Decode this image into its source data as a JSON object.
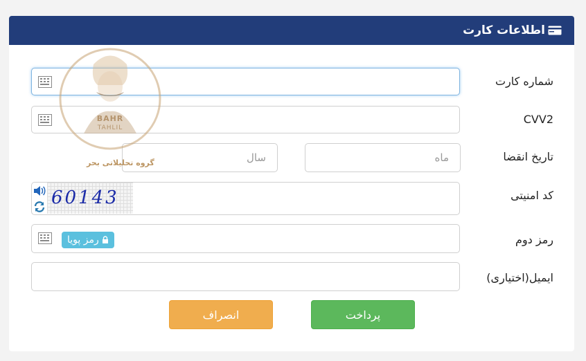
{
  "header": {
    "title": "اطلاعات کارت",
    "icon": "credit-card-icon"
  },
  "form": {
    "card_number_label": "شماره کارت",
    "cvv2_label": "CVV2",
    "expiry_label": "تاریخ انقضا",
    "month_placeholder": "ماه",
    "year_placeholder": "سال",
    "captcha_label": "کد امنیتی",
    "captcha_code": "60143",
    "second_password_label": "رمز دوم",
    "dynamic_password_button": "رمز پویا",
    "email_label": "ایمیل(اختیاری)"
  },
  "buttons": {
    "pay": "پرداخت",
    "cancel": "انصراف"
  },
  "watermark": {
    "brand": "BAHR TAHLIL",
    "tagline": "گروه تحلیلاتی بحر"
  },
  "colors": {
    "header": "#223d7a",
    "pay": "#5cb85c",
    "cancel": "#f0ad4e",
    "badge": "#5bc0de"
  }
}
